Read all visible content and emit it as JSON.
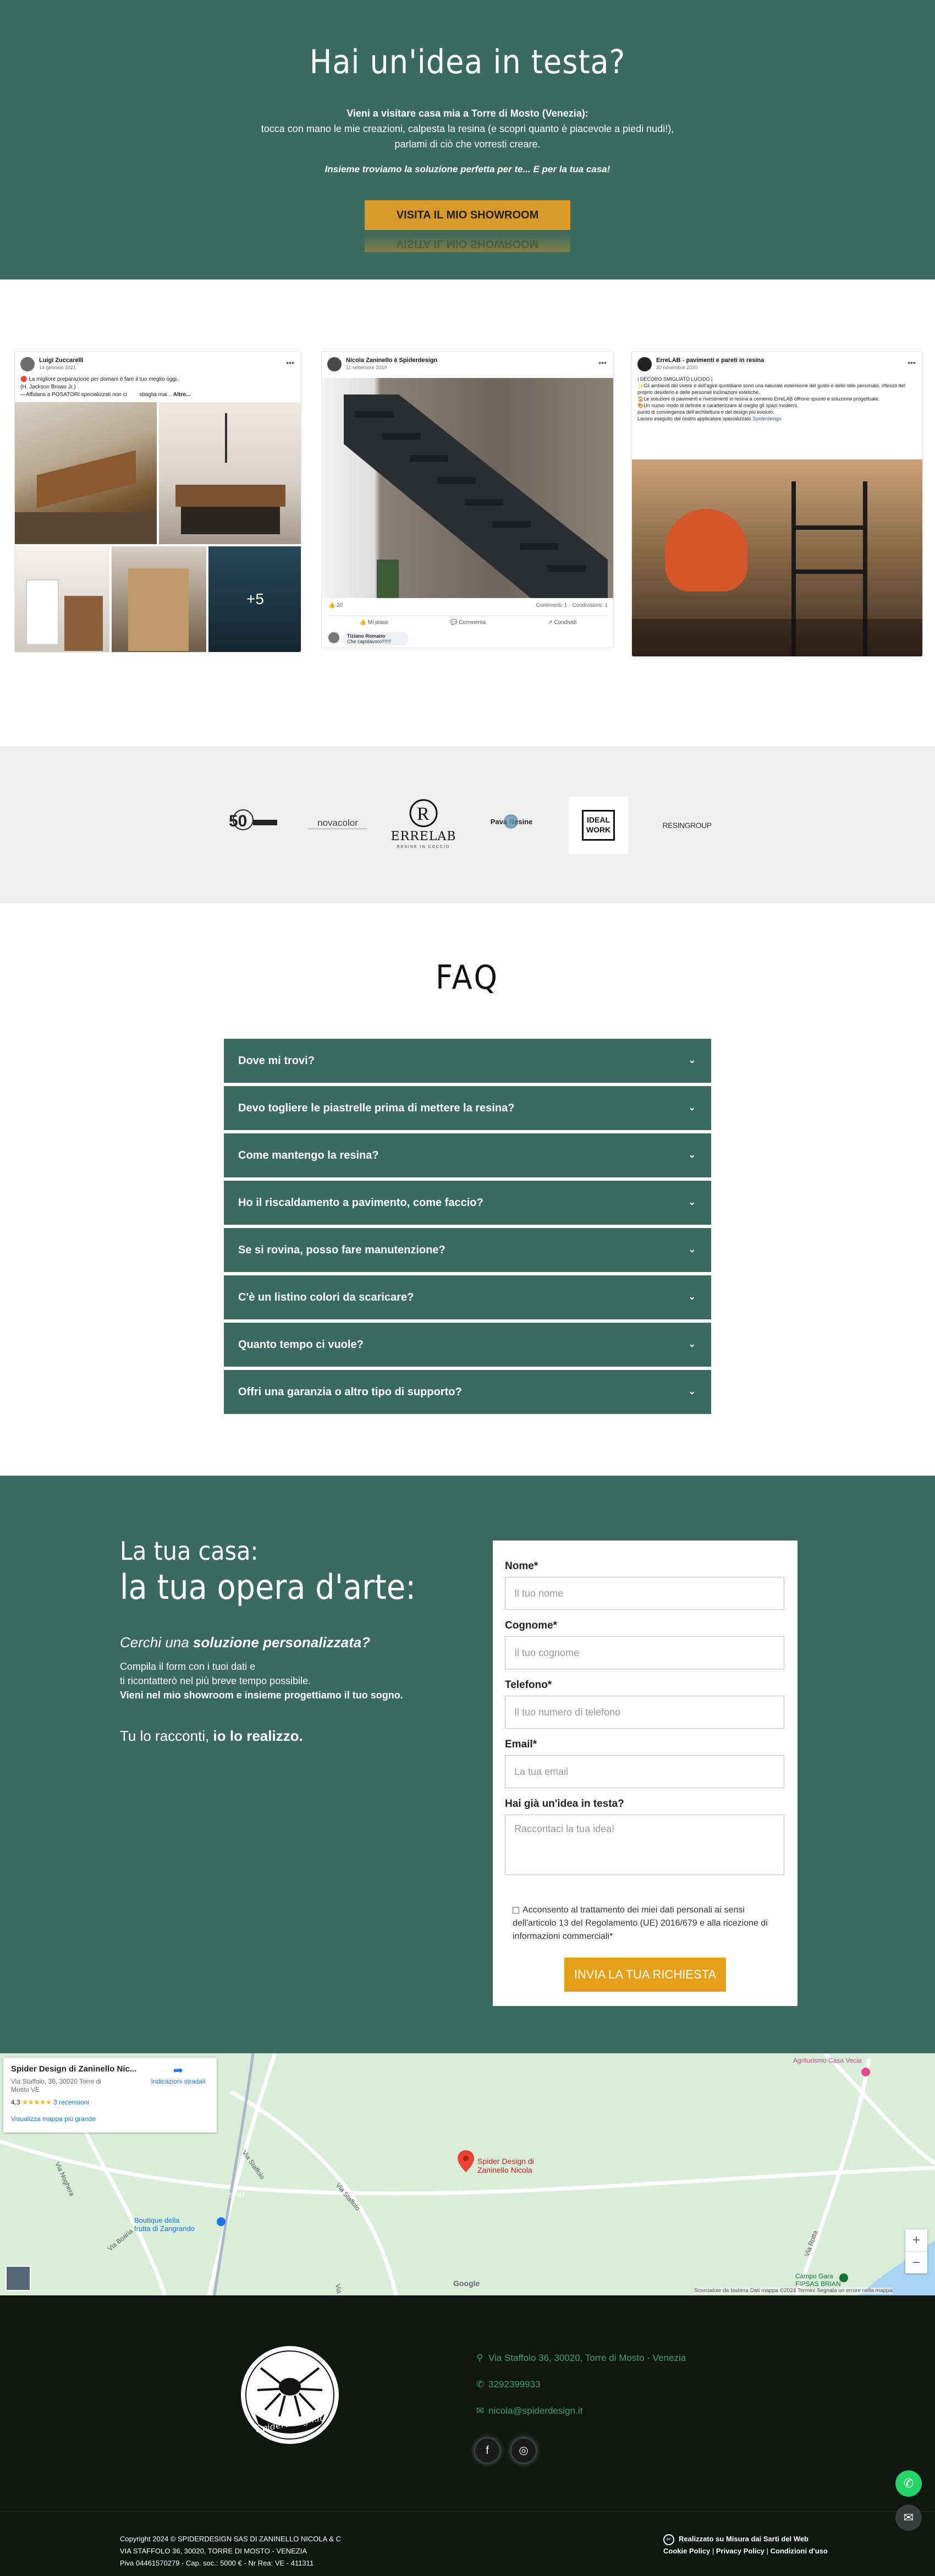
{
  "hero": {
    "title": "Hai un'idea in testa?",
    "line1_bold": "Vieni a visitare casa mia a Torre di Mosto (Venezia):",
    "line2": "tocca con mano le mie creazioni, calpesta la resina (e scopri quanto è piacevole a piedi nudi!),",
    "line3": "parlami di ciò che vorresti creare.",
    "tagline": "Insieme troviamo la soluzione perfetta per te... E per la tua casa!",
    "cta": "VISITA IL MIO SHOWROOM"
  },
  "posts": [
    {
      "author": "Luigi Zuccarelli",
      "date": "14 gennaio 2021",
      "text1": "La migliore preparazione per domani è fare il tuo meglio oggi.",
      "text2": "(H. Jackson Brown Jr.)",
      "text3": "—Affidarsi a POSATORI specializzati non ci",
      "text3b": "sbaglia mai...",
      "more": "Altro...",
      "more_photos": "+5"
    },
    {
      "author": "Nicola Zaninello è Spiderdesign",
      "date": "11 settembre 2019",
      "reactions": "20",
      "comments": "Commenti: 1 · Condivisioni: 1",
      "like": "Mi piace",
      "comment": "Commenta",
      "share": "Condividi",
      "reply_name": "Tiziano Romano",
      "reply_text": "Che capolavoro!!!!!!!"
    },
    {
      "author": "ErreLAB - pavimenti e pareti in resina",
      "date": "30 novembre 2020",
      "t1": "| DECORO SMIGLIATO LUCIDO |",
      "t2": "✨Gli ambienti del vivere e dell'agire quotidiano sono una naturale estensione del gusto e dello stile personale, riflesso del proprio desiderio e delle personali inclinazioni estetiche.",
      "t3": "🏠Le soluzioni di pavimenti e rivestimenti in resina a cemento ErreLAB offrono spunto e soluzione progettuale.",
      "t4": "🎨Un nuovo modo di definire e caratterizzare al meglio gli spazi moderni.",
      "t5": "punto di convergenza dell'architettura e del design più evoluto.",
      "t6": "Lavoro eseguito dal nostro applicatore specializzato",
      "t6link": "Spiderdesign"
    }
  ],
  "logos": [
    "50",
    "novacolor",
    "ERRELAB",
    "Pava Resine",
    "IDEAL WORK",
    "RESINGROUP"
  ],
  "logo_sub": "RESINE IN COCCIO",
  "faq": {
    "title": "FAQ",
    "items": [
      "Dove mi trovi?",
      "Devo togliere le piastrelle prima di mettere la resina?",
      "Come mantengo la resina?",
      "Ho il riscaldamento a pavimento, come faccio?",
      "Se si rovina, posso fare manutenzione?",
      "C'è un listino colori da scaricare?",
      "Quanto tempo ci vuole?",
      "Offri una garanzia o altro tipo di supporto?"
    ]
  },
  "contact": {
    "title1": "La tua casa:",
    "title2": "la tua opera d'arte:",
    "q_pre": "Cerchi una ",
    "q_bold": "soluzione personalizzata?",
    "d1": "Compila il form con i tuoi dati e",
    "d2": "ti ricontatterò nel più breve tempo possibile.",
    "d3": "Vieni nel mio showroom e insieme progettiamo il tuo sogno.",
    "r_pre": "Tu lo racconti, ",
    "r_bold": "io lo realizzo.",
    "form": {
      "nome_label": "Nome*",
      "nome_ph": "Il tuo nome",
      "cognome_label": "Cognome*",
      "cognome_ph": "Il tuo cognome",
      "tel_label": "Telefono*",
      "tel_ph": "Il tuo numero di telefono",
      "email_label": "Email*",
      "email_ph": "La tua email",
      "idea_label": "Hai già un'idea in testa?",
      "idea_ph": "Raccontaci la tua idea!",
      "consent": "Acconsento al trattamento dei miei dati personali ai sensi dell'articolo 13 del Regolamento (UE) 2016/679 e alla ricezione di informazioni commerciali*",
      "submit": "INVIA LA TUA RICHIESTA"
    }
  },
  "map": {
    "place": "Spider Design di Zaninello Nic...",
    "addr1": "Via Staffolo, 36, 30020 Torre di",
    "addr2": "Mosto VE",
    "rating": "4,3",
    "stars": "★★★★★",
    "reviews": "3 recensioni",
    "directions": "Indicazioni stradali",
    "view_larger": "Visualizza mappa più grande",
    "pin_label1": "Spider Design di",
    "pin_label2": "Zaninello Nicola",
    "poi1": "Agriturismo Casa Vecia",
    "poi2a": "Boutique della",
    "poi2b": "frutta di Zangrando",
    "poi3a": "Campo Gara",
    "poi3b": "FIPSAS BRIAN",
    "roads": [
      "Via Staffolo",
      "Via Staffolo",
      "Via Noghera",
      "Via Rotta",
      "Via Boaria",
      "Via Staffolo",
      "SP47"
    ],
    "google": "Google",
    "attribution": "Scorciatoie da tastiera   Dati mappa ©2024   Termini   Segnala un errore nella mappa",
    "zoom_in": "+",
    "zoom_out": "−"
  },
  "footer": {
    "logo_text": "Spiderdesign.it",
    "address": "Via Staffolo 36, 30020, Torre di Mosto - Venezia",
    "phone": "3292399933",
    "email": "nicola@spiderdesign.it",
    "copy1": "Copyright 2024 © SPIDERDESIGN SAS DI ZANINELLO NICOLA & C",
    "copy2": "VIA STAFFOLO 36, 30020, TORRE DI MOSTO - VENEZIA",
    "copy3": "Piva 04461570279 - Cap. soc.: 5000 € - Nr Rea: VE - 411311",
    "credit": "Realizzato su Misura dai Sarti del Web",
    "cookie": "Cookie Policy",
    "privacy": "Privacy Policy",
    "cond": "Condizioni d'uso"
  },
  "colors": {
    "green": "#3b6b5e",
    "gold": "#d99a2b",
    "whatsapp": "#25d366",
    "footer": "#101713"
  }
}
